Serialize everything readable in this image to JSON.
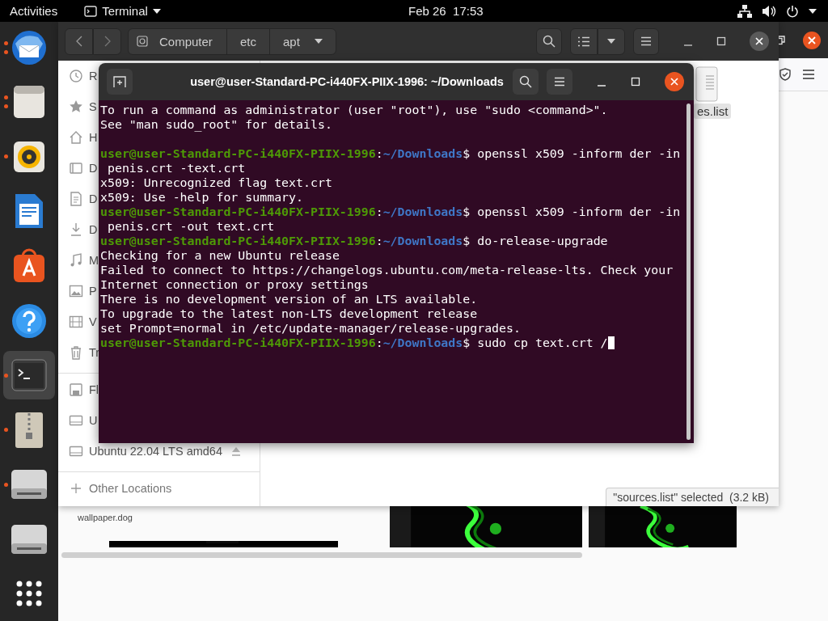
{
  "top_bar": {
    "activities": "Activities",
    "app_menu": "Terminal",
    "clock": "Feb 26  17:53"
  },
  "dock": [
    {
      "kind": "mail",
      "running": true,
      "multiple": true,
      "selected": false
    },
    {
      "kind": "files",
      "running": true,
      "multiple": true,
      "selected": false
    },
    {
      "kind": "music",
      "running": true,
      "multiple": false,
      "selected": false
    },
    {
      "kind": "document",
      "running": false,
      "selected": false
    },
    {
      "kind": "store",
      "running": false,
      "selected": false
    },
    {
      "kind": "help",
      "running": false,
      "selected": false
    },
    {
      "kind": "terminal",
      "running": true,
      "multiple": false,
      "selected": true
    },
    {
      "kind": "archive",
      "running": true,
      "multiple": false,
      "selected": false
    },
    {
      "kind": "drive",
      "running": true,
      "multiple": false,
      "selected": false
    },
    {
      "kind": "drive",
      "running": false,
      "selected": false
    },
    {
      "kind": "apps",
      "running": false,
      "selected": false
    }
  ],
  "browser": {
    "source": "wallpaper.dog"
  },
  "file_manager": {
    "path": [
      {
        "label": "Computer",
        "kind": "root"
      },
      {
        "label": "etc",
        "kind": "folder"
      },
      {
        "label": "apt",
        "kind": "current"
      }
    ],
    "sidebar": [
      {
        "items": [
          {
            "label": "R",
            "kind": "recent"
          },
          {
            "label": "S",
            "kind": "starred"
          },
          {
            "label": "H",
            "kind": "home"
          },
          {
            "label": "D",
            "kind": "desktop"
          },
          {
            "label": "D",
            "kind": "documents"
          },
          {
            "label": "D",
            "kind": "downloads"
          },
          {
            "label": "M",
            "kind": "music"
          },
          {
            "label": "P",
            "kind": "pictures"
          },
          {
            "label": "V",
            "kind": "videos"
          },
          {
            "label": "Tr",
            "kind": "trash"
          }
        ]
      },
      {
        "items": [
          {
            "label": "Fl",
            "kind": "floppy"
          },
          {
            "label": "U",
            "kind": "drive"
          },
          {
            "label": "Ubuntu 22.04 LTS amd64",
            "kind": "disc"
          }
        ]
      },
      {
        "items": [
          {
            "label": "Other Locations",
            "kind": "other"
          }
        ]
      }
    ],
    "files": [
      {
        "label": "es.list",
        "selected": true
      }
    ],
    "status": "\"sources.list\" selected  (3.2 kB)"
  },
  "terminal": {
    "title": "user@user-Standard-PC-i440FX-PIIX-1996: ~/Downloads",
    "lines": [
      {
        "kind": "output",
        "text": "To run a command as administrator (user \"root\"), use \"sudo <command>\"."
      },
      {
        "kind": "output",
        "text": "See \"man sudo_root\" for details."
      },
      {
        "kind": "blank"
      },
      {
        "kind": "prompt",
        "user": "user@user-Standard-PC-i440FX-PIIX-1996",
        "sep": ":",
        "path": "~/Downloads",
        "command": "$ openssl x509 -inform der -in",
        "cursor": false
      },
      {
        "kind": "output",
        "text": " penis.crt -text.crt"
      },
      {
        "kind": "output",
        "text": "x509: Unrecognized flag text.crt"
      },
      {
        "kind": "output",
        "text": "x509: Use -help for summary."
      },
      {
        "kind": "prompt",
        "user": "user@user-Standard-PC-i440FX-PIIX-1996",
        "sep": ":",
        "path": "~/Downloads",
        "command": "$ openssl x509 -inform der -in",
        "cursor": false
      },
      {
        "kind": "output",
        "text": " penis.crt -out text.crt"
      },
      {
        "kind": "prompt",
        "user": "user@user-Standard-PC-i440FX-PIIX-1996",
        "sep": ":",
        "path": "~/Downloads",
        "command": "$ do-release-upgrade",
        "cursor": false
      },
      {
        "kind": "output",
        "text": "Checking for a new Ubuntu release"
      },
      {
        "kind": "output",
        "text": "Failed to connect to https://changelogs.ubuntu.com/meta-release-lts. Check your"
      },
      {
        "kind": "output",
        "text": "Internet connection or proxy settings"
      },
      {
        "kind": "output",
        "text": "There is no development version of an LTS available."
      },
      {
        "kind": "output",
        "text": "To upgrade to the latest non-LTS development release"
      },
      {
        "kind": "output",
        "text": "set Prompt=normal in /etc/update-manager/release-upgrades."
      },
      {
        "kind": "prompt",
        "user": "user@user-Standard-PC-i440FX-PIIX-1996",
        "sep": ":",
        "path": "~/Downloads",
        "command": "$ sudo cp text.crt /",
        "cursor": true
      }
    ]
  }
}
